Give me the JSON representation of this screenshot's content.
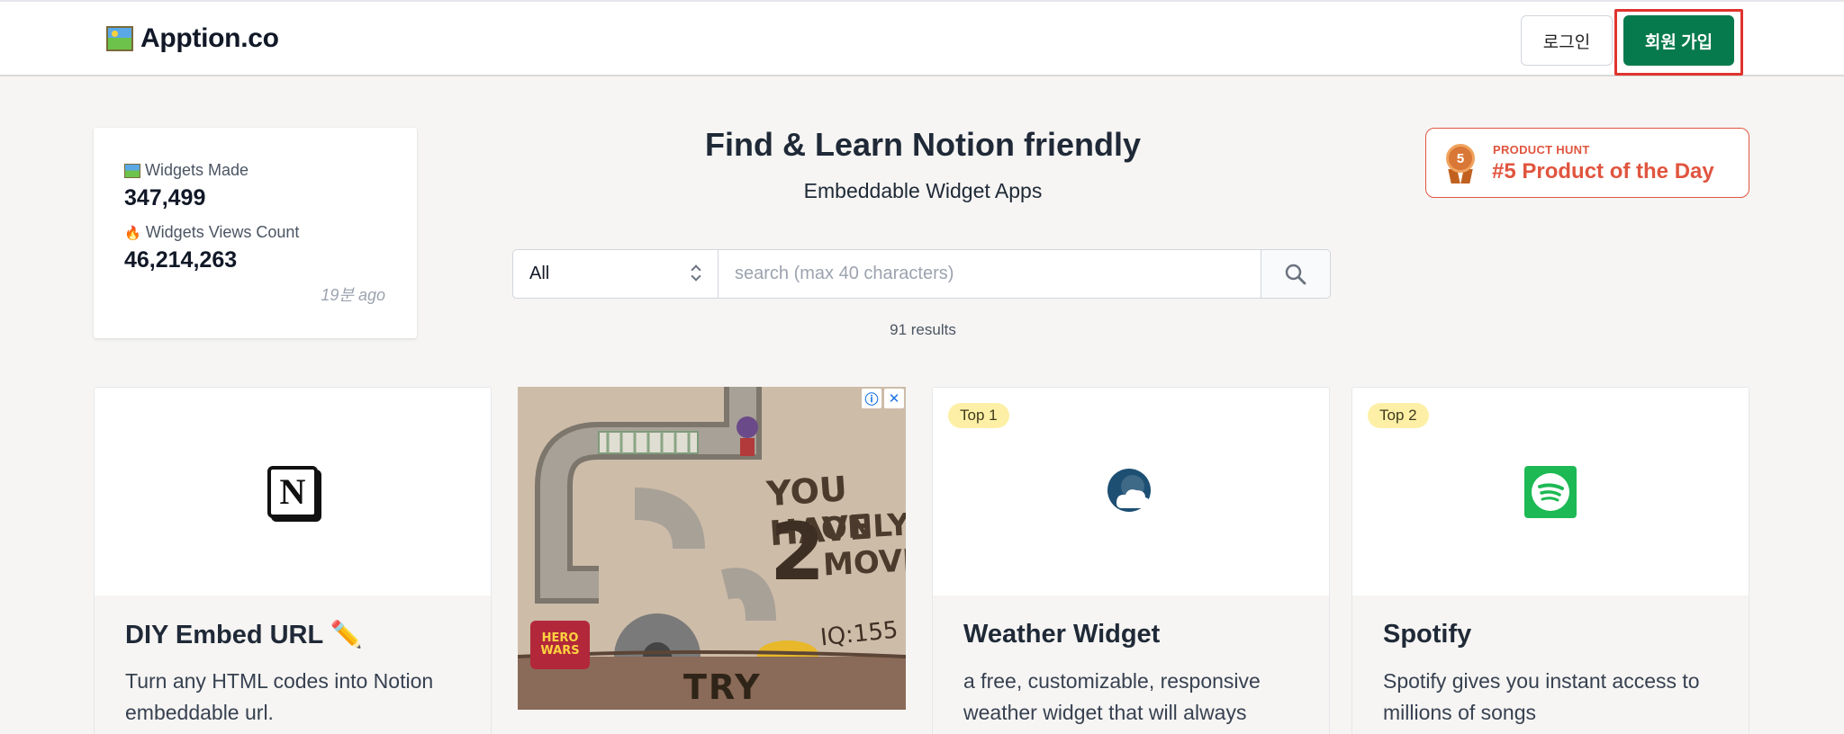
{
  "header": {
    "logo_text": "Apption.co",
    "login_label": "로그인",
    "signup_label": "회원 가입"
  },
  "stats": {
    "widgets_made_label": "Widgets Made",
    "widgets_made_value": "347,499",
    "views_label": "Widgets Views Count",
    "views_value": "46,214,263",
    "updated": "19분 ago"
  },
  "hero": {
    "title": "Find & Learn Notion friendly",
    "subtitle": "Embeddable Widget Apps"
  },
  "product_hunt": {
    "rank": "5",
    "label": "PRODUCT HUNT",
    "title": "#5 Product of the Day"
  },
  "search": {
    "category_value": "All",
    "placeholder": "search (max 40 characters)",
    "results_text": "91 results"
  },
  "cards": [
    {
      "icon": "notion-icon",
      "icon_letter": "N",
      "title": "DIY Embed URL ✏️",
      "desc": "Turn any HTML codes into Notion embeddable url."
    },
    {
      "icon": "weather-icon",
      "badge": "Top 1",
      "title": "Weather Widget",
      "desc": "a free, customizable, responsive weather widget that will always"
    },
    {
      "icon": "spotify-icon",
      "badge": "Top 2",
      "title": "Spotify",
      "desc": "Spotify gives you instant access to millions of songs"
    }
  ],
  "ad": {
    "info_icon": "info-icon",
    "close_icon": "close-icon",
    "headline_top": "YOU HAVE",
    "headline_number": "2",
    "headline_rest_1": "ONLY",
    "headline_rest_2": "MOVES",
    "iq_text": "IQ:155",
    "cta": "TRY",
    "brand": "HERO WARS"
  },
  "colors": {
    "accent": "#077a4d",
    "highlight": "#e0332e",
    "product_hunt": "#e0553f",
    "badge": "#fdf0a6"
  }
}
